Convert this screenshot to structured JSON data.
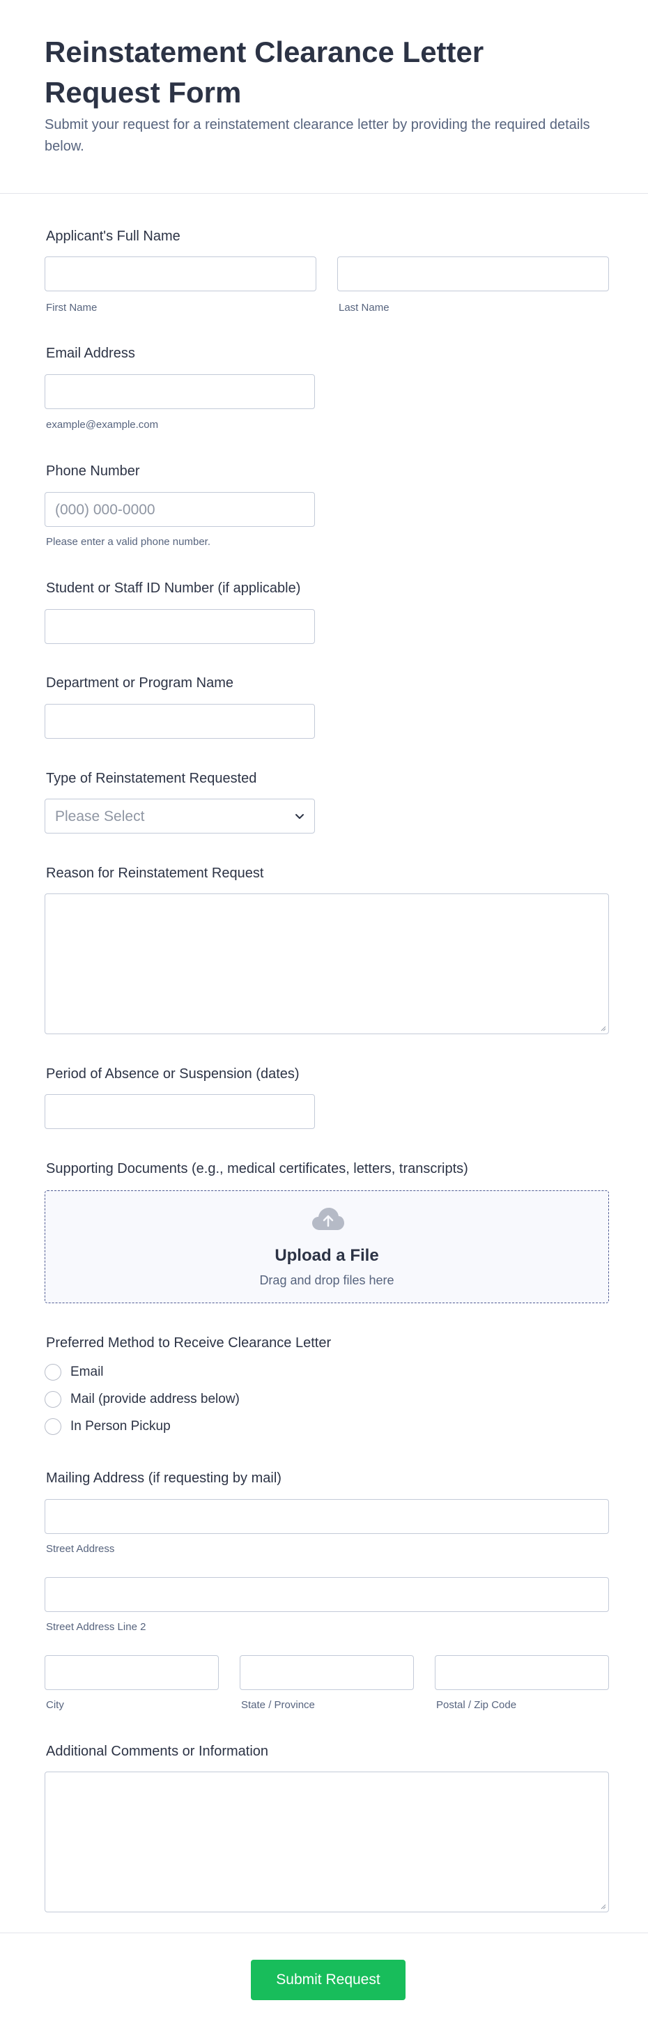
{
  "header": {
    "title": "Reinstatement Clearance Letter Request Form",
    "subtitle": "Submit your request for a reinstatement clearance letter by providing the required details below."
  },
  "fields": {
    "full_name": {
      "label": "Applicant's Full Name",
      "first_sublabel": "First Name",
      "last_sublabel": "Last Name"
    },
    "email": {
      "label": "Email Address",
      "sublabel": "example@example.com"
    },
    "phone": {
      "label": "Phone Number",
      "placeholder": "(000) 000-0000",
      "sublabel": "Please enter a valid phone number."
    },
    "id_number": {
      "label": "Student or Staff ID Number (if applicable)"
    },
    "department": {
      "label": "Department or Program Name"
    },
    "reinstatement_type": {
      "label": "Type of Reinstatement Requested",
      "placeholder": "Please Select"
    },
    "reason": {
      "label": "Reason for Reinstatement Request"
    },
    "absence_period": {
      "label": "Period of Absence or Suspension (dates)"
    },
    "documents": {
      "label": "Supporting Documents (e.g., medical certificates, letters, transcripts)",
      "upload_title": "Upload a File",
      "upload_subtitle": "Drag and drop files here",
      "icon": "cloud-upload-icon"
    },
    "method": {
      "label": "Preferred Method to Receive Clearance Letter",
      "options": [
        "Email",
        "Mail (provide address below)",
        "In Person Pickup"
      ]
    },
    "address": {
      "label": "Mailing Address (if requesting by mail)",
      "street_sublabel": "Street Address",
      "street2_sublabel": "Street Address Line 2",
      "city_sublabel": "City",
      "state_sublabel": "State / Province",
      "postal_sublabel": "Postal / Zip Code"
    },
    "comments": {
      "label": "Additional Comments or Information"
    }
  },
  "footer": {
    "submit_label": "Submit Request"
  },
  "colors": {
    "submit": "#18bd5b",
    "text": "#2c3345",
    "muted": "#57647e",
    "border": "#c3cad8"
  }
}
